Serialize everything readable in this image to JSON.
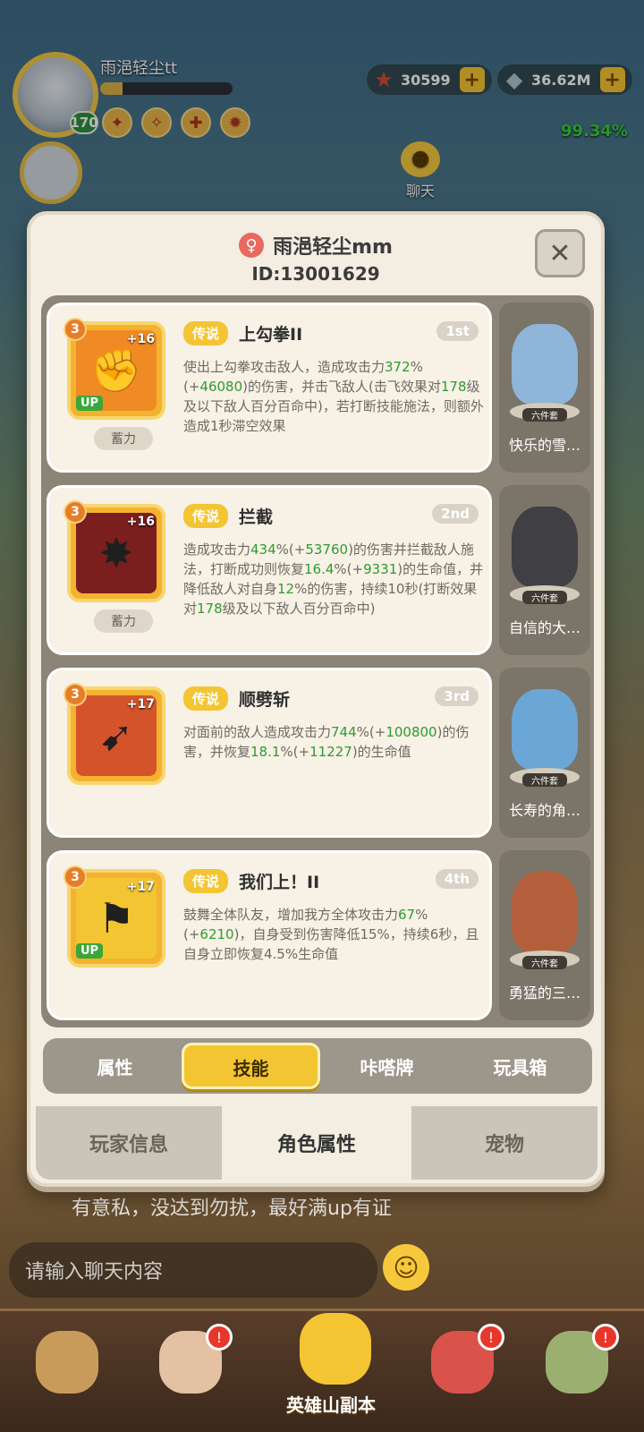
{
  "hud": {
    "player_name": "雨浥轻尘tt",
    "level": "170",
    "xp_fraction": 0.17,
    "currency1": "30599",
    "currency2": "36.62M",
    "percent": "99.34%",
    "chat_label": "聊天"
  },
  "dialog": {
    "name": "雨浥轻尘mm",
    "id_text": "ID:13001629",
    "close_label": "✕",
    "skills": [
      {
        "level": "3",
        "plus": "+16",
        "up": "UP",
        "tag": "蓄力",
        "rarity": "传说",
        "name": "上勾拳II",
        "rank": "1st",
        "desc_parts": [
          {
            "t": "使出上勾拳攻击敌人，造成攻击力",
            "g": false
          },
          {
            "t": "372",
            "g": true
          },
          {
            "t": "%(+",
            "g": false
          },
          {
            "t": "46080",
            "g": true
          },
          {
            "t": ")的伤害，并击飞敌人(击飞效果对",
            "g": false
          },
          {
            "t": "178",
            "g": true
          },
          {
            "t": "级及以下敌人百分百命中)，若打断技能施法，则额外造成1秒滞空效果",
            "g": false
          }
        ],
        "pet": {
          "name": "快乐的雪…",
          "set": "六件套"
        }
      },
      {
        "level": "3",
        "plus": "+16",
        "up": "",
        "tag": "蓄力",
        "rarity": "传说",
        "name": "拦截",
        "rank": "2nd",
        "desc_parts": [
          {
            "t": "造成攻击力",
            "g": false
          },
          {
            "t": "434",
            "g": true
          },
          {
            "t": "%(+",
            "g": false
          },
          {
            "t": "53760",
            "g": true
          },
          {
            "t": ")的伤害并拦截敌人施法，打断成功则恢复",
            "g": false
          },
          {
            "t": "16.4",
            "g": true
          },
          {
            "t": "%(+",
            "g": false
          },
          {
            "t": "9331",
            "g": true
          },
          {
            "t": ")的生命值，并降低敌人对自身",
            "g": false
          },
          {
            "t": "12",
            "g": true
          },
          {
            "t": "%的伤害，持续10秒(打断效果对",
            "g": false
          },
          {
            "t": "178",
            "g": true
          },
          {
            "t": "级及以下敌人百分百命中)",
            "g": false
          }
        ],
        "pet": {
          "name": "自信的大…",
          "set": "六件套"
        }
      },
      {
        "level": "3",
        "plus": "+17",
        "up": "",
        "tag": "",
        "rarity": "传说",
        "name": "顺劈斩",
        "rank": "3rd",
        "desc_parts": [
          {
            "t": "对面前的敌人造成攻击力",
            "g": false
          },
          {
            "t": "744",
            "g": true
          },
          {
            "t": "%(+",
            "g": false
          },
          {
            "t": "100800",
            "g": true
          },
          {
            "t": ")的伤害，并恢复",
            "g": false
          },
          {
            "t": "18.1",
            "g": true
          },
          {
            "t": "%(+",
            "g": false
          },
          {
            "t": "11227",
            "g": true
          },
          {
            "t": ")的生命值",
            "g": false
          }
        ],
        "pet": {
          "name": "长寿的角…",
          "set": "六件套"
        }
      },
      {
        "level": "3",
        "plus": "+17",
        "up": "UP",
        "tag": "",
        "rarity": "传说",
        "name": "我们上！II",
        "rank": "4th",
        "desc_parts": [
          {
            "t": "鼓舞全体队友，增加我方全体攻击力",
            "g": false
          },
          {
            "t": "67",
            "g": true
          },
          {
            "t": "%(+",
            "g": false
          },
          {
            "t": "6210",
            "g": true
          },
          {
            "t": ")，自身受到伤害降低15%，持续6秒，且自身立即恢复4.5%生命值",
            "g": false
          }
        ],
        "pet": {
          "name": "勇猛的三…",
          "set": "六件套"
        }
      }
    ],
    "skill_tabs": [
      "属性",
      "技能",
      "咔嗒牌",
      "玩具箱"
    ],
    "main_tabs": [
      "玩家信息",
      "角色属性",
      "宠物"
    ]
  },
  "chat": {
    "last_message": "有意私，没达到勿扰，最好满up有证",
    "input_placeholder": "请输入聊天内容"
  },
  "bottom_nav": {
    "center_label": "英雄山副本"
  },
  "colors": {
    "accent_yellow": "#f4c533",
    "highlight_green": "#2e9c2e",
    "dialog_bg": "#f3ede2"
  }
}
